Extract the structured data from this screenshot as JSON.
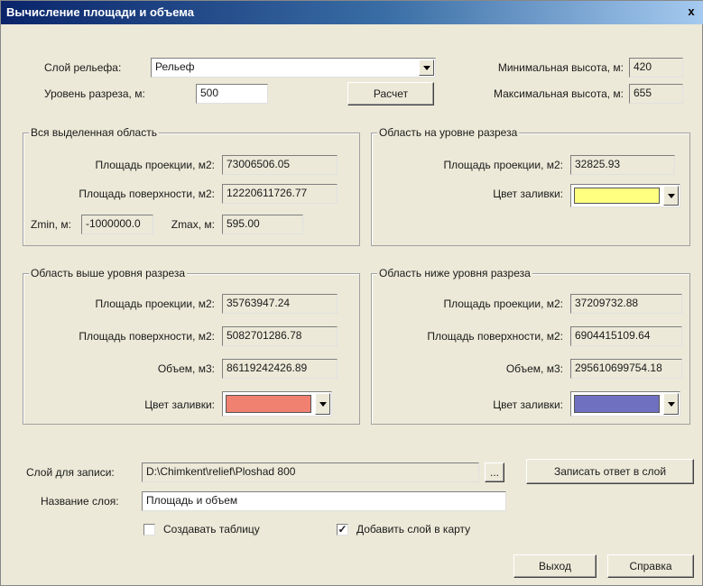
{
  "window": {
    "title": "Вычисление площади и объема",
    "close_glyph": "x"
  },
  "top": {
    "relief_layer_label": "Слой рельефа:",
    "relief_layer_value": "Рельеф",
    "cut_level_label": "Уровень разреза, м:",
    "cut_level_value": "500",
    "calc_button": "Расчет",
    "min_height_label": "Минимальная высота, м:",
    "min_height_value": "420",
    "max_height_label": "Максимальная высота, м:",
    "max_height_value": "655"
  },
  "whole_area": {
    "title": "Вся выделенная область",
    "proj_label": "Площадь проекции, м2:",
    "proj_value": "73006506.05",
    "surf_label": "Площадь поверхности, м2:",
    "surf_value": "12220611726.77",
    "zmin_label": "Zmin, м:",
    "zmin_value": "-1000000.0",
    "zmax_label": "Zmax, м:",
    "zmax_value": "595.00"
  },
  "cut_area": {
    "title": "Область на уровне разреза",
    "proj_label": "Площадь проекции, м2:",
    "proj_value": "32825.93",
    "fill_label": "Цвет заливки:",
    "fill_color": "#ffff80"
  },
  "above_area": {
    "title": "Область выше уровня разреза",
    "proj_label": "Площадь проекции, м2:",
    "proj_value": "35763947.24",
    "surf_label": "Площадь поверхности, м2:",
    "surf_value": "5082701286.78",
    "vol_label": "Объем, м3:",
    "vol_value": "86119242426.89",
    "fill_label": "Цвет заливки:",
    "fill_color": "#f08070"
  },
  "below_area": {
    "title": "Область ниже уровня разреза",
    "proj_label": "Площадь проекции, м2:",
    "proj_value": "37209732.88",
    "surf_label": "Площадь поверхности, м2:",
    "surf_value": "6904415109.64",
    "vol_label": "Объем, м3:",
    "vol_value": "295610699754.18",
    "fill_label": "Цвет заливки:",
    "fill_color": "#7070c0"
  },
  "bottom": {
    "write_layer_label": "Слой для записи:",
    "write_layer_value": "D:\\Chimkent\\relief\\Ploshad 800",
    "browse_button": "...",
    "write_answer_button": "Записать ответ в слой",
    "layer_name_label": "Название слоя:",
    "layer_name_value": "Площадь и объем",
    "create_table_label": "Создавать таблицу",
    "add_to_map_label": "Добавить слой в карту",
    "exit_button": "Выход",
    "help_button": "Справка"
  }
}
